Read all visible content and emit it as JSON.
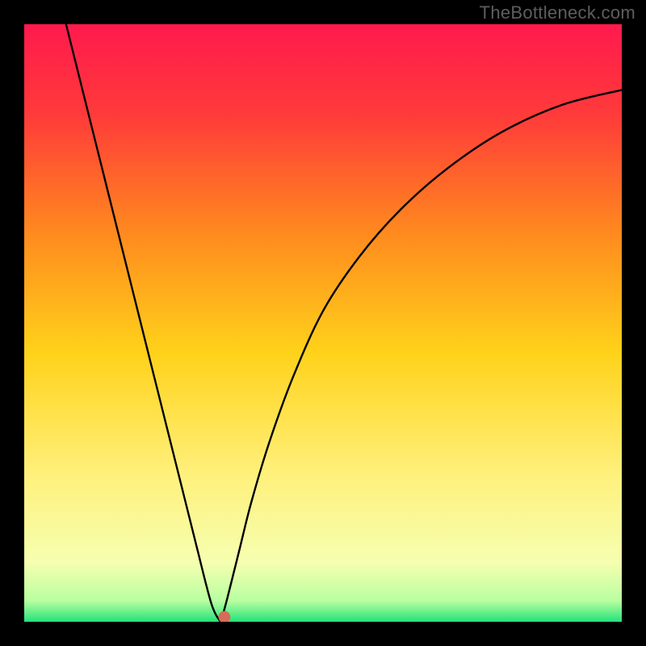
{
  "watermark": "TheBottleneck.com",
  "chart_data": {
    "type": "line",
    "title": "",
    "xlabel": "",
    "ylabel": "",
    "xlim": [
      0,
      100
    ],
    "ylim": [
      0,
      100
    ],
    "background_gradient": {
      "stops": [
        {
          "offset": 0.0,
          "color": "#ff1a4d"
        },
        {
          "offset": 0.15,
          "color": "#ff3a3a"
        },
        {
          "offset": 0.35,
          "color": "#ff8a1e"
        },
        {
          "offset": 0.55,
          "color": "#ffd21a"
        },
        {
          "offset": 0.75,
          "color": "#fff07a"
        },
        {
          "offset": 0.9,
          "color": "#f6ffb0"
        },
        {
          "offset": 0.965,
          "color": "#b8ffa0"
        },
        {
          "offset": 1.0,
          "color": "#23e27a"
        }
      ]
    },
    "series": [
      {
        "name": "curve",
        "color": "#000000",
        "x": [
          7,
          9,
          11,
          13,
          15,
          17,
          19,
          21,
          23,
          25,
          27,
          29,
          30.5,
          31.5,
          32.5,
          33,
          34,
          36,
          38,
          41,
          45,
          50,
          56,
          63,
          71,
          80,
          90,
          100
        ],
        "y": [
          100,
          92,
          84,
          76,
          68,
          60,
          52,
          44,
          36,
          28,
          20,
          12,
          6,
          2.5,
          0.5,
          0.5,
          4,
          12,
          20,
          30,
          41,
          52,
          61,
          69,
          76,
          82,
          86.5,
          89
        ]
      }
    ],
    "marker": {
      "x": 33.5,
      "y": 0.8,
      "radius_percent": 1.0,
      "color": "#d86a5a"
    }
  }
}
